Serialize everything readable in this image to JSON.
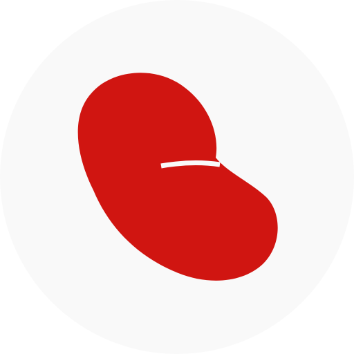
{
  "icon": {
    "name": "red-bean-logo",
    "colors": {
      "background_circle": "#f9f9f9",
      "page_background": "#ffffff",
      "logo_red": "#d01511",
      "cut_line": "#f9f9f9"
    }
  }
}
